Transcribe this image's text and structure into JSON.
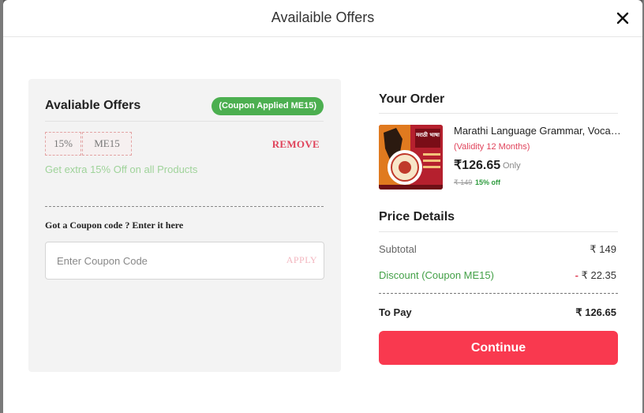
{
  "modal": {
    "title": "Availaible Offers"
  },
  "offers": {
    "title": "Avaliable Offers",
    "applied_badge": "(Coupon Applied ME15)",
    "coupon_percent": "15%",
    "coupon_code": "ME15",
    "remove_label": "REMOVE",
    "description": "Get extra 15% Off on all Products",
    "prompt": "Got a Coupon code ? Enter it here",
    "input_placeholder": "Enter Coupon Code",
    "input_value": "",
    "apply_label": "APPLY"
  },
  "order": {
    "title": "Your Order",
    "product": {
      "name": "Marathi Language Grammar, Vocabulary",
      "validity": "(Validity 12 Months)",
      "price": "₹126.65",
      "price_suffix": "Only",
      "mrp": "₹ 149",
      "discount_percent": "15% off",
      "thumbnail_text": "मराठी भाषा"
    }
  },
  "price_details": {
    "title": "Price Details",
    "subtotal_label": "Subtotal",
    "subtotal_value": "₹ 149",
    "discount_label": "Discount (Coupon ME15)",
    "discount_sign": "-",
    "discount_value": "₹ 22.35",
    "to_pay_label": "To Pay",
    "to_pay_value": "₹ 126.65"
  },
  "continue_label": "Continue",
  "colors": {
    "accent": "#f9394f",
    "success": "#4caf50",
    "remove": "#e0435b",
    "discount": "#43a047"
  }
}
